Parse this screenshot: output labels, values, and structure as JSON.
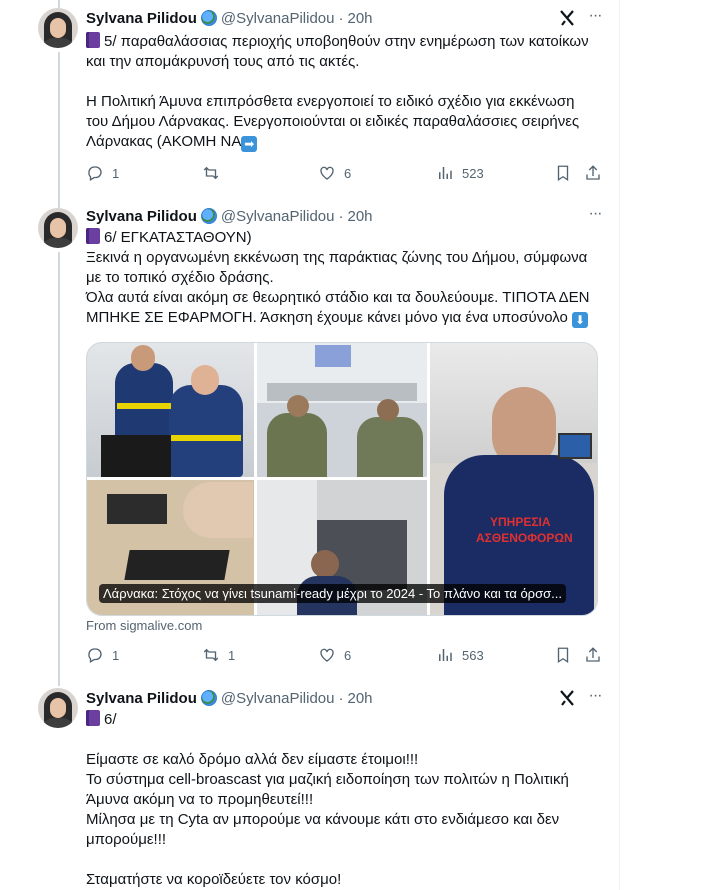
{
  "tweets": [
    {
      "name": "Sylvana Pilidou",
      "handle": "@SylvanaPilidou",
      "time": "20h",
      "lines": [
        "5/ παραθαλάσσιας περιοχής υποβοηθούν στην ενημέρωση των κατοίκων",
        "και την απομάκρυνσή τους από τις ακτές.",
        "",
        "Η Πολιτική Άμυνα επιπρόσθετα ενεργοποιεί το ειδικό σχέδιο για εκκένωση",
        "του Δήμου Λάρνακας. Ενεργοποιούνται οι ειδικές παραθαλάσσιες σειρήνες",
        "Λάρνακας (ΑΚΟΜΗ ΝΑ"
      ],
      "stats": {
        "replies": "1",
        "retweets": "",
        "likes": "6",
        "views": "523"
      }
    },
    {
      "name": "Sylvana Pilidou",
      "handle": "@SylvanaPilidou",
      "time": "20h",
      "lines": [
        "6/ ΕΓΚΑΤΑΣΤΑΘΟΥΝ)",
        "Ξεκινά η οργανωμένη εκκένωση της παράκτιας ζώνης του Δήμου, σύμφωνα",
        "με το τοπικό σχέδιο δράσης.",
        "Όλα αυτά είναι ακόμη σε θεωρητικό στάδιο και τα δουλεύουμε. ΤΙΠΟΤΑ ΔΕΝ",
        "ΜΠΗΚΕ ΣΕ ΕΦΑΡΜΟΓΗ. Άσκηση έχουμε κάνει μόνο για ένα υποσύνολο"
      ],
      "card_caption": "Λάρνακα: Στόχος να γίνει tsunami-ready μέχρι το 2024 - Το πλάνο και τα όρσσ...",
      "card_from": "From sigmalive.com",
      "stats": {
        "replies": "1",
        "retweets": "1",
        "likes": "6",
        "views": "563"
      }
    },
    {
      "name": "Sylvana Pilidou",
      "handle": "@SylvanaPilidou",
      "time": "20h",
      "lines": [
        "6/",
        "",
        "Είμαστε σε καλό δρόμο αλλά δεν είμαστε έτοιμοι!!!",
        "Το σύστημα cell-broascast για μαζική ειδοποίηση των πολιτών η Πολιτική",
        "Άμυνα ακόμη να το προμηθευτεί!!!",
        "Μίλησα με τη Cyta αν μπορούμε να κάνουμε κάτι στο ενδιάμεσο και δεν",
        "μπορούμε!!!",
        "",
        "Σταματήστε να κοροϊδεύετε τον κόσμο!"
      ]
    }
  ],
  "icons": {
    "verified_globe": "globe-emoji",
    "book": "purple-book-emoji",
    "arrow_right": "right-arrow-emoji",
    "arrow_down": "down-arrow-emoji",
    "grok": "grok-icon",
    "more": "more-icon"
  },
  "colors": {
    "secondary_text": "#536471",
    "thread_line": "#cfd9de",
    "emoji_blue": "#3b94d9"
  }
}
